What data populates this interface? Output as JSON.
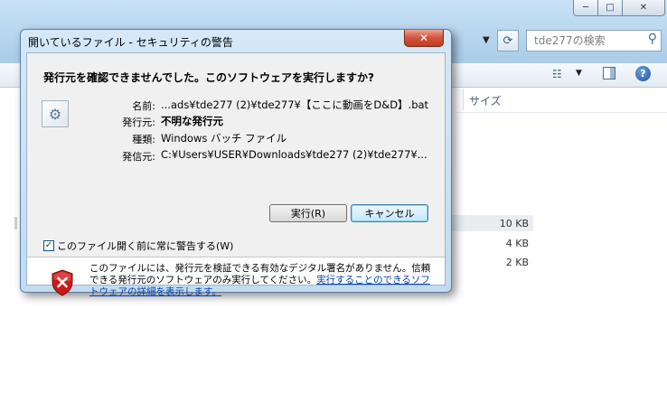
{
  "explorer": {
    "search_placeholder": "tde277の検索",
    "window_buttons": {
      "minimize": "─",
      "maximize": "□",
      "close": "✕"
    },
    "column_size": "サイズ",
    "file_sizes": [
      "10 KB",
      "4 KB",
      "2 KB"
    ]
  },
  "dialog": {
    "title": "開いているファイル - セキュリティの警告",
    "close_label": "✕",
    "question": "発行元を確認できませんでした。このソフトウェアを実行しますか?",
    "fields": {
      "name_label": "名前:",
      "name_value": "...ads¥tde277 (2)¥tde277¥【ここに動画をD&D】.bat",
      "publisher_label": "発行元:",
      "publisher_value": "不明な発行元",
      "type_label": "種類:",
      "type_value": "Windows バッチ ファイル",
      "from_label": "発信元:",
      "from_value": "C:¥Users¥USER¥Downloads¥tde277 (2)¥tde277¥..."
    },
    "run_button": "実行(R)",
    "cancel_button": "キャンセル",
    "checkbox_label": "このファイル開く前に常に警告する(W)",
    "checkbox_checked": true,
    "warning_text": "このファイルには、発行元を検証できる有効なデジタル署名がありません。信頼できる発行元のソフトウェアのみ実行してください。",
    "warning_link": "実行することのできるソフトウェアの詳細を表示します。"
  },
  "colors": {
    "title_gradient_top": "#d6e8f7",
    "close_red": "#c13b22",
    "link_blue": "#0645ad",
    "shield_red": "#cc1a1a"
  }
}
